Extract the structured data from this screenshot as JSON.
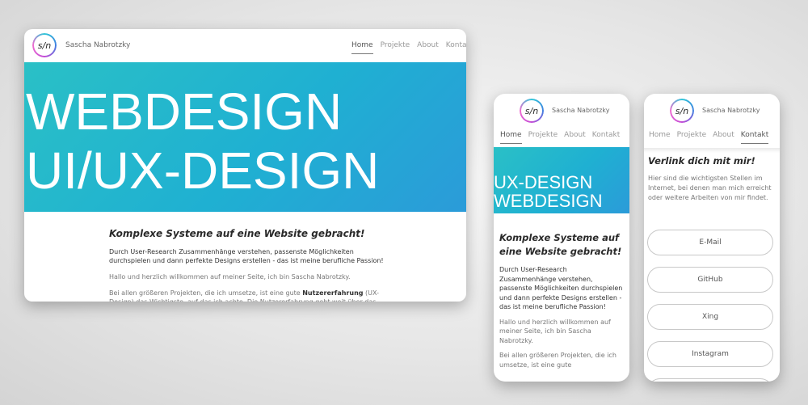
{
  "site": {
    "logo": "s/n",
    "name": "Sascha Nabrotzky",
    "nav": [
      "Home",
      "Projekte",
      "About",
      "Kontakt"
    ]
  },
  "desktop": {
    "hero_lines": [
      "WEBDESIGN",
      "UI/UX-DESIGN"
    ],
    "headline": "Komplexe Systeme auf eine Website gebracht!",
    "intro": "Durch User-Research Zusammenhänge verstehen, passenste Möglichkeiten durchspielen und dann perfekte Designs erstellen - das ist meine berufliche Passion!",
    "welcome": "Hallo und herzlich willkommen auf meiner Seite, ich bin Sascha Nabrotzky.",
    "projects_pre": "Bei allen größeren Projekten, die ich umsetze, ist eine gute ",
    "projects_bold": "Nutzererfahrung",
    "projects_post": " (UX-Design) das Wichtigste, auf das ich achte. Die Nutzererfahrung geht weit über das"
  },
  "phone_home": {
    "hero_lines": [
      "UX-DESIGN",
      "WEBDESIGN"
    ],
    "headline": "Komplexe Systeme auf eine Website gebracht!",
    "intro": "Durch User-Research Zusammenhänge verstehen, passenste Möglichkeiten durchspielen und dann perfekte Designs erstellen - das ist meine berufliche Passion!",
    "welcome": "Hallo und herzlich willkommen auf meiner Seite, ich bin Sascha Nabrotzky.",
    "projects": "Bei allen größeren Projekten, die ich umsetze, ist eine gute"
  },
  "phone_contact": {
    "headline": "Verlink dich mit mir!",
    "text": "Hier sind die wichtigsten Stellen im Internet, bei denen man mich erreicht oder weitere Arbeiten von mir findet.",
    "links": [
      "E-Mail",
      "GitHub",
      "Xing",
      "Instagram"
    ]
  }
}
